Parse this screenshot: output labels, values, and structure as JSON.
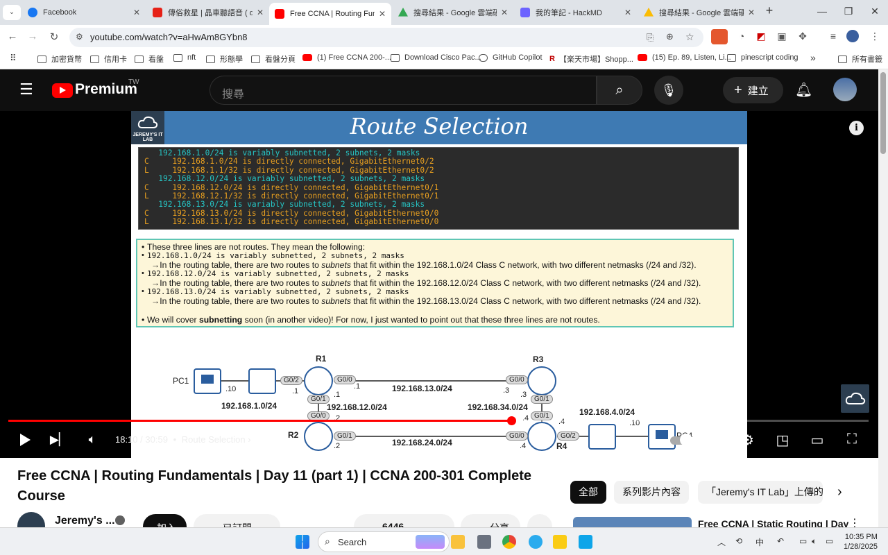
{
  "browser": {
    "tabs": [
      {
        "title": "Facebook",
        "color": "#1877f2"
      },
      {
        "title": "傳俗救星 | 晶車聽語音 ( de",
        "color": "#e62117"
      },
      {
        "title": "Free CCNA | Routing Fund",
        "color": "#ff0000",
        "active": true
      },
      {
        "title": "搜尋結果 - Google 雲端硬",
        "color": "#34a853"
      },
      {
        "title": "我的筆記 - HackMD",
        "color": "#6c63ff"
      },
      {
        "title": "搜尋結果 - Google 雲端硬",
        "color": "#fbbc04"
      }
    ],
    "new_tab": "+",
    "url": "youtube.com/watch?v=aHwAm8GYbn8",
    "bookmarks": [
      {
        "label": "加密貨幣",
        "type": "folder"
      },
      {
        "label": "信用卡",
        "type": "folder"
      },
      {
        "label": "看盤",
        "type": "folder"
      },
      {
        "label": "nft",
        "type": "folder"
      },
      {
        "label": "形態學",
        "type": "folder"
      },
      {
        "label": "看盤分頁",
        "type": "folder"
      },
      {
        "label": "(1) Free CCNA 200-...",
        "type": "yt"
      },
      {
        "label": "Download Cisco Pac...",
        "type": "folder"
      },
      {
        "label": "GitHub Copilot",
        "type": "folder"
      },
      {
        "label": "【楽天市場】Shopp...",
        "type": "rakuten"
      },
      {
        "label": "(15) Ep. 89, Listen, Li...",
        "type": "yt"
      },
      {
        "label": "pinescript coding",
        "type": "folder"
      }
    ],
    "bookmarks_more": "»",
    "all_bookmarks": "所有書籤"
  },
  "youtube": {
    "logo": "Premium",
    "region": "TW",
    "search_placeholder": "搜尋",
    "create_label": "建立"
  },
  "slide": {
    "title": "Route Selection",
    "logo_text": "JEREMY'S IT LAB",
    "terminal": [
      {
        "code": " ",
        "text": "  192.168.1.0/24 is variably subnetted, 2 subnets, 2 masks",
        "color": "cyan"
      },
      {
        "code": "C",
        "text": "     192.168.1.0/24 is directly connected, GigabitEthernet0/2",
        "color": "orange"
      },
      {
        "code": "L",
        "text": "     192.168.1.1/32 is directly connected, GigabitEthernet0/2",
        "color": "orange"
      },
      {
        "code": " ",
        "text": "  192.168.12.0/24 is variably subnetted, 2 subnets, 2 masks",
        "color": "cyan"
      },
      {
        "code": "C",
        "text": "     192.168.12.0/24 is directly connected, GigabitEthernet0/1",
        "color": "orange"
      },
      {
        "code": "L",
        "text": "     192.168.12.1/32 is directly connected, GigabitEthernet0/1",
        "color": "orange"
      },
      {
        "code": " ",
        "text": "  192.168.13.0/24 is variably subnetted, 2 subnets, 2 masks",
        "color": "cyan"
      },
      {
        "code": "C",
        "text": "     192.168.13.0/24 is directly connected, GigabitEthernet0/0",
        "color": "orange"
      },
      {
        "code": "L",
        "text": "     192.168.13.1/32 is directly connected, GigabitEthernet0/0",
        "color": "orange"
      }
    ],
    "notes": {
      "intro": "These three lines are not routes. They mean the following:",
      "items": [
        {
          "code": "192.168.1.0/24 is variably subnetted, 2 subnets, 2 masks",
          "pre": "→In the routing table, there are two routes to ",
          "em": "subnets",
          "post": " that fit within the 192.168.1.0/24 Class C network, with two different netmasks (/24 and /32)."
        },
        {
          "code": "192.168.12.0/24 is variably subnetted, 2 subnets, 2 masks",
          "pre": "→In the routing table, there are two routes to ",
          "em": "subnets",
          "post": " that fit within the 192.168.12.0/24 Class C network, with two different netmasks (/24 and /32)."
        },
        {
          "code": "192.168.13.0/24 is variably subnetted, 2 subnets, 2 masks",
          "pre": "→In the routing table, there are two routes to ",
          "em": "subnets",
          "post": " that fit within the 192.168.13.0/24 Class C network, with two different netmasks (/24 and /32)."
        }
      ],
      "footer_pre": "We will cover ",
      "footer_bold": "subnetting",
      "footer_post": " soon (in another video)! For now, I just wanted to point out that these three lines are not routes."
    },
    "topology": {
      "pc1": "PC1",
      "pc4": "PC4",
      "r1": "R1",
      "r2": "R2",
      "r3": "R3",
      "r4": "R4",
      "net1": "192.168.1.0/24",
      "net12": "192.168.12.0/24",
      "net13": "192.168.13.0/24",
      "net24": "192.168.24.0/24",
      "net34": "192.168.34.0/24",
      "net4": "192.168.4.0/24",
      "g02": "G0/2",
      "g01": "G0/1",
      "g00": "G0/0",
      "h10": ".10",
      "h1": ".1",
      "h2": ".2",
      "h3": ".3",
      "h4": ".4"
    }
  },
  "player": {
    "current_time": "18:10",
    "separator": "/",
    "duration": "30:59",
    "chapter": "Route Selection",
    "progress": 0.585
  },
  "video": {
    "title": "Free CCNA | Routing Fundamentals | Day 11 (part 1) | CCNA 200-301 Complete Course",
    "channel": "Jeremy's ...",
    "join_label": "加入",
    "subscribed_label": "已訂閱",
    "likes": "6446",
    "share_label": "分享",
    "chips": [
      "全部",
      "系列影片內容",
      "「Jeremy's IT Lab」上傳的"
    ],
    "rec_title": "Free CCNA | Static Routing | Day"
  },
  "taskbar": {
    "search_placeholder": "Search",
    "lang": "中",
    "time": "10:35 PM",
    "date": "1/28/2025"
  }
}
